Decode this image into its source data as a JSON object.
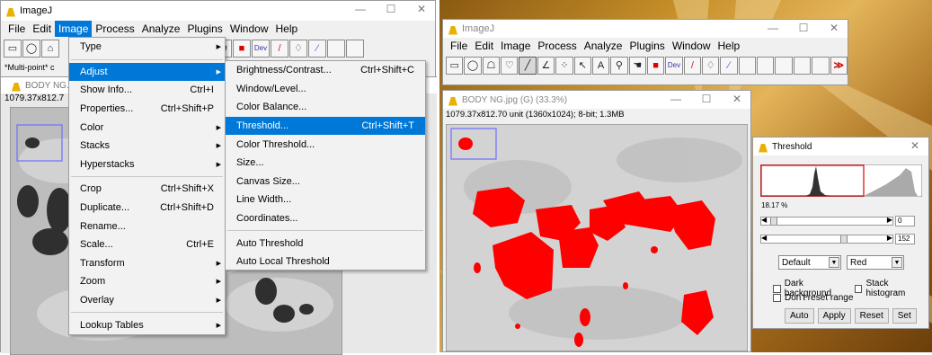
{
  "left": {
    "window_title": "ImageJ",
    "menubar": [
      "File",
      "Edit",
      "Image",
      "Process",
      "Analyze",
      "Plugins",
      "Window",
      "Help"
    ],
    "status_text": "*Multi-point* c",
    "image_title": "BODY NG.j",
    "image_info": "1079.37x812.7",
    "image_menu": [
      {
        "label": "Type",
        "shortcut": "",
        "submenu": true
      },
      {
        "label": "Adjust",
        "shortcut": "",
        "submenu": true
      },
      {
        "label": "Show Info...",
        "shortcut": "Ctrl+I",
        "submenu": false
      },
      {
        "label": "Properties...",
        "shortcut": "Ctrl+Shift+P",
        "submenu": false
      },
      {
        "label": "Color",
        "shortcut": "",
        "submenu": true
      },
      {
        "label": "Stacks",
        "shortcut": "",
        "submenu": true
      },
      {
        "label": "Hyperstacks",
        "shortcut": "",
        "submenu": true
      },
      {
        "label": "Crop",
        "shortcut": "Ctrl+Shift+X",
        "submenu": false
      },
      {
        "label": "Duplicate...",
        "shortcut": "Ctrl+Shift+D",
        "submenu": false
      },
      {
        "label": "Rename...",
        "shortcut": "",
        "submenu": false
      },
      {
        "label": "Scale...",
        "shortcut": "Ctrl+E",
        "submenu": false
      },
      {
        "label": "Transform",
        "shortcut": "",
        "submenu": true
      },
      {
        "label": "Zoom",
        "shortcut": "",
        "submenu": true
      },
      {
        "label": "Overlay",
        "shortcut": "",
        "submenu": true
      },
      {
        "label": "Lookup Tables",
        "shortcut": "",
        "submenu": true
      }
    ],
    "adjust_menu": [
      {
        "label": "Brightness/Contrast...",
        "shortcut": "Ctrl+Shift+C"
      },
      {
        "label": "Window/Level...",
        "shortcut": ""
      },
      {
        "label": "Color Balance...",
        "shortcut": ""
      },
      {
        "label": "Threshold...",
        "shortcut": "Ctrl+Shift+T"
      },
      {
        "label": "Color Threshold...",
        "shortcut": ""
      },
      {
        "label": "Size...",
        "shortcut": ""
      },
      {
        "label": "Canvas Size...",
        "shortcut": ""
      },
      {
        "label": "Line Width...",
        "shortcut": ""
      },
      {
        "label": "Coordinates...",
        "shortcut": ""
      },
      {
        "label": "Auto Threshold",
        "shortcut": ""
      },
      {
        "label": "Auto Local Threshold",
        "shortcut": ""
      }
    ]
  },
  "right": {
    "window_title": "ImageJ",
    "menubar": [
      "File",
      "Edit",
      "Image",
      "Process",
      "Analyze",
      "Plugins",
      "Window",
      "Help"
    ],
    "image_title": "BODY NG.jpg (G) (33.3%)",
    "image_info": "1079.37x812.70 unit (1360x1024); 8-bit; 1.3MB",
    "threshold": {
      "title": "Threshold",
      "percent": "18.17 %",
      "min_value": "0",
      "max_value": "152",
      "method": "Default",
      "mode": "Red",
      "dark_background": "Dark background",
      "stack_histogram": "Stack histogram",
      "dont_reset": "Don't reset range",
      "buttons": [
        "Auto",
        "Apply",
        "Reset",
        "Set"
      ]
    }
  },
  "colors": {
    "accent": "#0078d7",
    "threshold_red": "#ff0000"
  }
}
